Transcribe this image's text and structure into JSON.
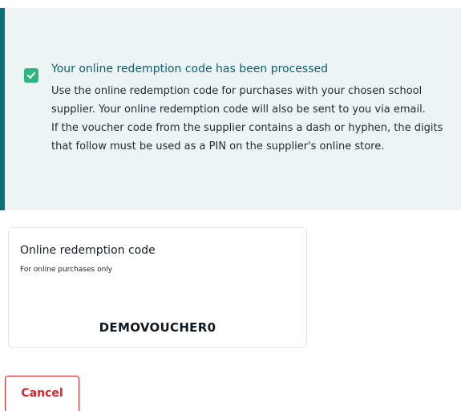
{
  "alert": {
    "title": "Your online redemption code has been processed",
    "line1": "Use the online redemption code for purchases with your chosen school supplier. Your online redemption code will also be sent to you via email.",
    "line2": "If the voucher code from the supplier contains a dash or hyphen, the digits that follow must be used as a PIN on the supplier's online store."
  },
  "code_card": {
    "title": "Online redemption code",
    "subtitle": "For online purchases only",
    "code": "DEMOVOUCHER0"
  },
  "actions": {
    "cancel_label": "Cancel"
  },
  "colors": {
    "accent": "#0f6f7a",
    "success": "#2eb67d",
    "danger": "#d8222a",
    "alert_bg": "#edf4f6"
  }
}
